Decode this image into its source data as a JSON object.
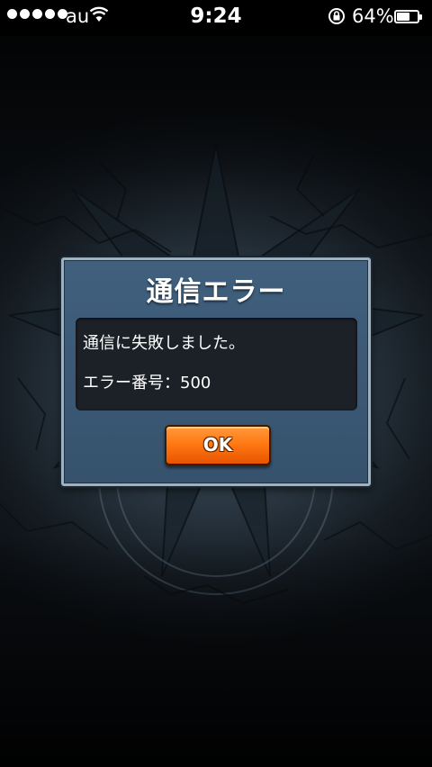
{
  "status_bar": {
    "carrier": "au",
    "time": "9:24",
    "battery_percent": "64%",
    "battery_level": 0.64,
    "signal_bars": 5,
    "icons": [
      "signal-dots-icon",
      "wifi-icon",
      "rotation-lock-icon",
      "battery-icon"
    ]
  },
  "dialog": {
    "title": "通信エラー",
    "message_line1": "通信に失敗しました。",
    "message_line2": "エラー番号：500",
    "ok_label": "OK"
  },
  "colors": {
    "dialog_bg": "#3b5875",
    "message_bg": "#1b2127",
    "ok_button": "#ff7a14",
    "text": "#ffffff"
  }
}
